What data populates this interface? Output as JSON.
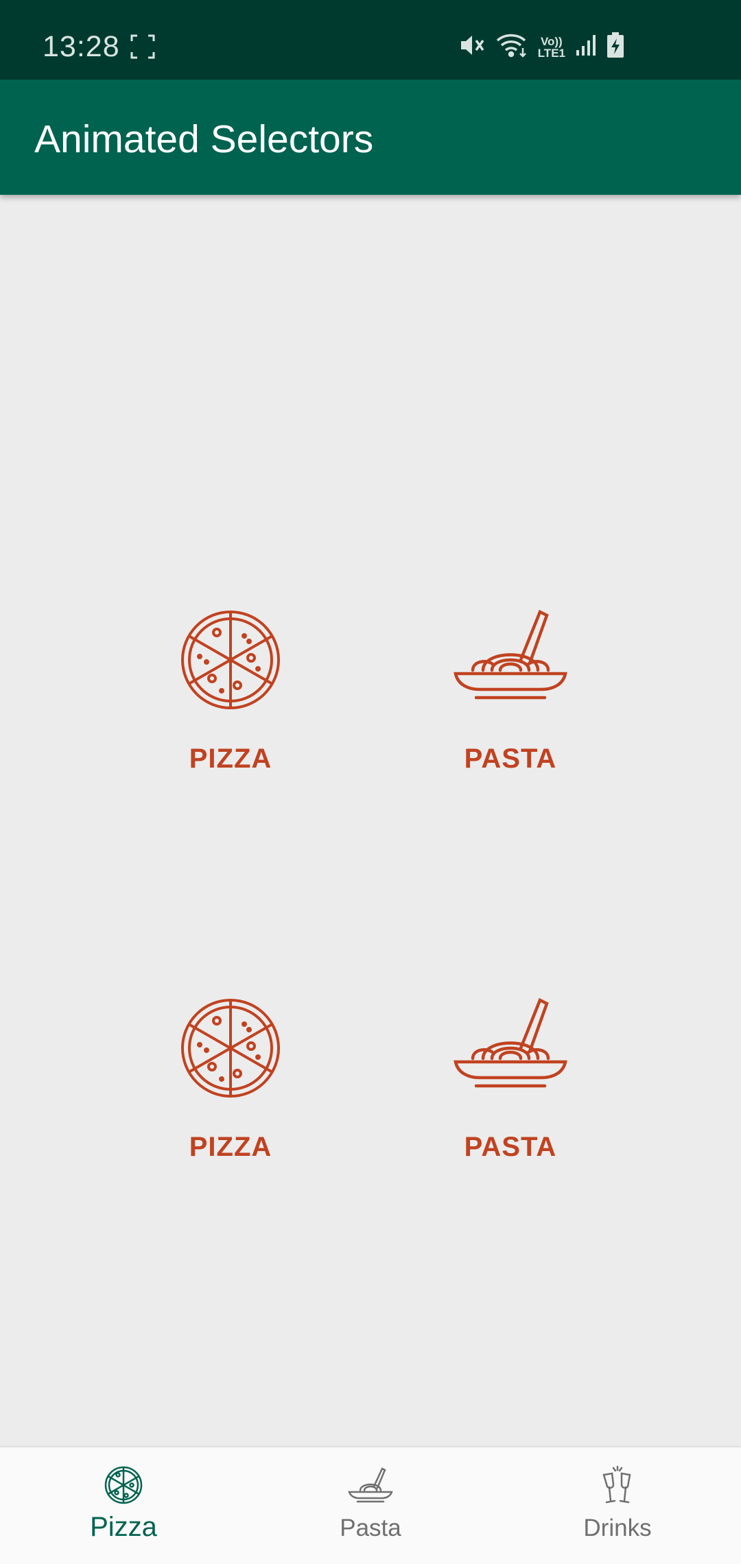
{
  "status_bar": {
    "time": "13:28",
    "icons": [
      "screen-capture-icon",
      "mute-icon",
      "wifi-icon",
      "volte-icon",
      "signal-icon",
      "battery-charging-icon"
    ],
    "volte_top": "Vo))",
    "volte_bottom": "LTE1"
  },
  "app_bar": {
    "title": "Animated Selectors"
  },
  "selectors": [
    {
      "label": "PIZZA",
      "icon": "pizza-icon"
    },
    {
      "label": "PASTA",
      "icon": "pasta-icon"
    },
    {
      "label": "PIZZA",
      "icon": "pizza-icon"
    },
    {
      "label": "PASTA",
      "icon": "pasta-icon"
    }
  ],
  "bottom_nav": {
    "items": [
      {
        "label": "Pizza",
        "icon": "pizza-icon",
        "active": true
      },
      {
        "label": "Pasta",
        "icon": "pasta-icon",
        "active": false
      },
      {
        "label": "Drinks",
        "icon": "drinks-icon",
        "active": false
      }
    ]
  },
  "colors": {
    "status_bar": "#003a2f",
    "app_bar": "#00634f",
    "accent": "#c14220",
    "nav_active": "#00634f",
    "nav_inactive": "#6f6f6f",
    "background": "#ececec"
  }
}
